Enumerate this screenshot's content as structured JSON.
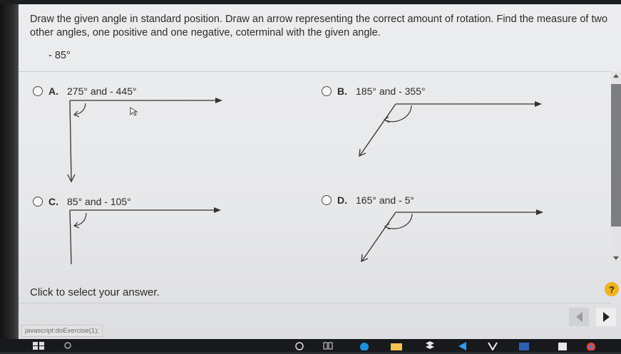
{
  "question": {
    "text": "Draw the given angle in standard position. Draw an arrow representing the correct amount of rotation. Find the measure of two other angles, one positive and one negative, coterminal with the given angle.",
    "given_angle": "- 85°"
  },
  "options": [
    {
      "letter": "A.",
      "text": "275° and - 445°"
    },
    {
      "letter": "B.",
      "text": "185° and - 355°"
    },
    {
      "letter": "C.",
      "text": "85° and - 105°"
    },
    {
      "letter": "D.",
      "text": "165° and - 5°"
    }
  ],
  "footer": {
    "instruction": "Click to select your answer.",
    "status": "javascript:doExercise(1);",
    "help": "?"
  },
  "taskbar": {
    "icons": [
      "start-icon",
      "search-icon",
      "cortana-icon",
      "taskview-icon",
      "edge-icon",
      "file-explorer-icon",
      "dropbox-icon",
      "app-icon",
      "vpn-icon",
      "word-icon",
      "app2-icon",
      "chrome-icon"
    ]
  }
}
